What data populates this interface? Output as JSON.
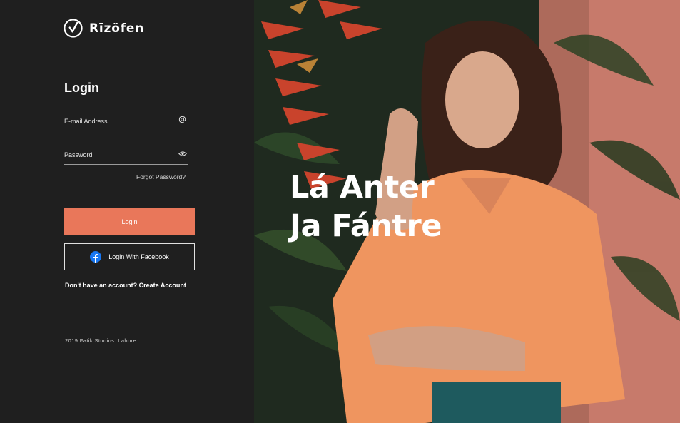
{
  "brand": {
    "name": "Rīzöfen"
  },
  "login": {
    "title": "Login",
    "email_placeholder": "E-mail Address",
    "password_placeholder": "Password",
    "forgot_label": "Forgot Password?",
    "submit_label": "Login",
    "facebook_label": "Login With Facebook",
    "signup_prompt": "Don't have an account?",
    "signup_link": "Create Account"
  },
  "footer": {
    "text": "2019 Fatik Studios. Lahore"
  },
  "hero": {
    "line1": "Lá Anter",
    "line2": "Ja Fántre"
  },
  "colors": {
    "accent": "#e9775a",
    "panel": "#1f1f1f",
    "facebook": "#1877f2"
  },
  "icons": {
    "email": "at-icon",
    "password": "eye-icon",
    "facebook": "facebook-icon",
    "logo": "checkmark-circle-icon"
  }
}
